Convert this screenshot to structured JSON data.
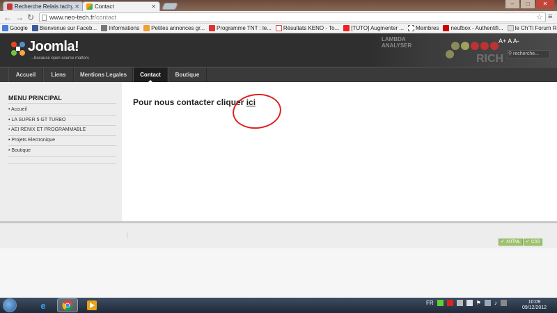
{
  "browser": {
    "tabs": [
      {
        "title": "Recherche Relais tachymè",
        "icon": "search-favicon",
        "active": false
      },
      {
        "title": "Contact",
        "icon": "joomla-favicon",
        "active": true
      }
    ],
    "url": {
      "host": "www.neo-tech.fr",
      "path": "/contact"
    },
    "bookmarks": [
      {
        "label": "Google",
        "icon": "google-favicon"
      },
      {
        "label": "Bienvenue sur Faceb...",
        "icon": "facebook-favicon"
      },
      {
        "label": "Informations",
        "icon": "page-favicon"
      },
      {
        "label": "Petites annonces gr...",
        "icon": "leboncoin-favicon"
      },
      {
        "label": "Programme TNT : le...",
        "icon": "tele-favicon"
      },
      {
        "label": "Résultats KENO - To...",
        "icon": "keno-favicon"
      },
      {
        "label": "[TUTO] Augmenter ...",
        "icon": "youtube-favicon"
      },
      {
        "label": "Membres",
        "icon": "members-favicon"
      },
      {
        "label": "neufbox - Authentifi...",
        "icon": "sfr-favicon"
      },
      {
        "label": "le Ch'Ti Forum Rena...",
        "icon": "forum-favicon"
      }
    ]
  },
  "site": {
    "logo_text": "Joomla!",
    "logo_tagline": "...because open source matters",
    "banner_text": [
      "LAMBDA",
      "ANALYSER"
    ],
    "banner_big": "RICH",
    "font_sizer": "A+ A A-",
    "search_placeholder": "recherche...",
    "nav": [
      {
        "label": "Accueil",
        "active": false
      },
      {
        "label": "Liens",
        "active": false
      },
      {
        "label": "Mentions Legales",
        "active": false
      },
      {
        "label": "Contact",
        "active": true
      },
      {
        "label": "Boutique",
        "active": false
      }
    ],
    "sidebar": {
      "title": "MENU PRINCIPAL",
      "items": [
        "Accueil",
        "LA SUPER 5 GT TURBO",
        "AEI RENIX ET PROGRAMMABLE",
        "Projets Electronique",
        "Boutique"
      ]
    },
    "main": {
      "text": "Pour nous contacter cliquer ",
      "link": "ici"
    },
    "footer": {
      "badges": [
        "XHTML",
        "CSS"
      ]
    }
  },
  "taskbar": {
    "lang": "FR",
    "time": "10:09",
    "date": "09/12/2012"
  },
  "colors": {
    "annotation_circle": "#e0201e",
    "header_bg": "#2f2f2f",
    "nav_active": "#1e1e1e"
  }
}
